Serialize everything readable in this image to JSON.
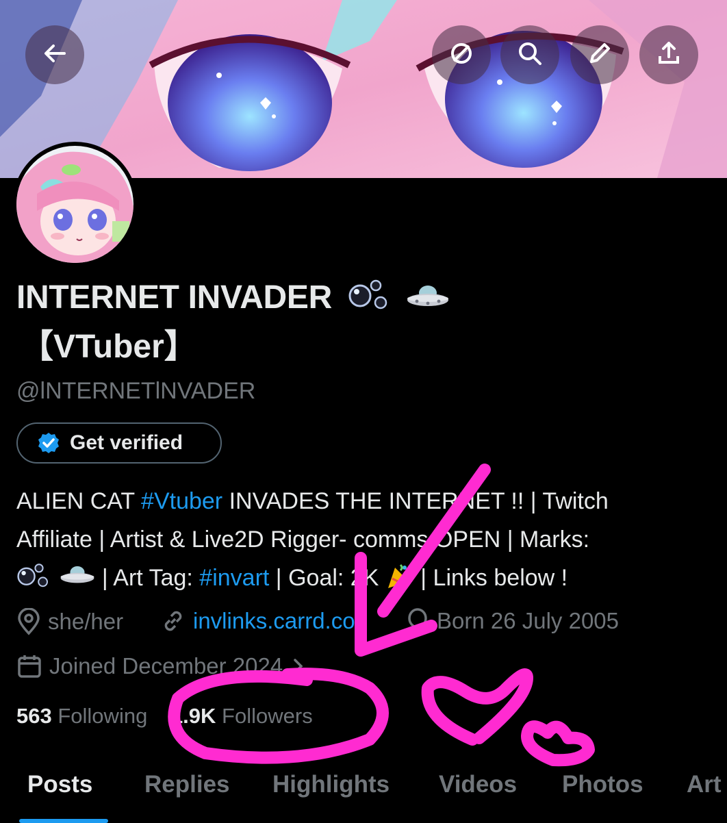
{
  "header": {
    "back_icon": "arrow-left-icon",
    "actions": [
      "mute-icon",
      "search-icon",
      "edit-icon",
      "share-icon"
    ]
  },
  "profile": {
    "name_line1": "INTERNET INVADER",
    "name_line2": "【VTuber】",
    "name_marks": [
      "bubbles-icon",
      "ufo-icon"
    ],
    "handle": "@lNTERNETlNVADER",
    "verify_button": "Get verified",
    "bio": {
      "line1_a": "ALIEN CAT ",
      "line1_tag": "#Vtuber",
      "line1_b": " INVADES THE INTERNET !! | Twitch",
      "line2": "Affiliate | Artist & Live2D Rigger- comms OPEN | Marks:",
      "line3_a": " | Art Tag: ",
      "line3_tag": "#invart",
      "line3_b": " | Goal: 2K ",
      "line3_c": " | Links below !"
    },
    "meta": {
      "pronouns": "she/her",
      "link": "invlinks.carrd.co",
      "birthday": "Born 26 July 2005",
      "joined": "Joined December 2024"
    },
    "counts": {
      "following_value": "563",
      "following_label": "Following",
      "followers_value": "1.9K",
      "followers_label": "Followers"
    }
  },
  "tabs": [
    "Posts",
    "Replies",
    "Highlights",
    "Videos",
    "Photos",
    "Art"
  ],
  "colors": {
    "accent": "#1d9bf0",
    "annotation": "#ff2bd1"
  }
}
